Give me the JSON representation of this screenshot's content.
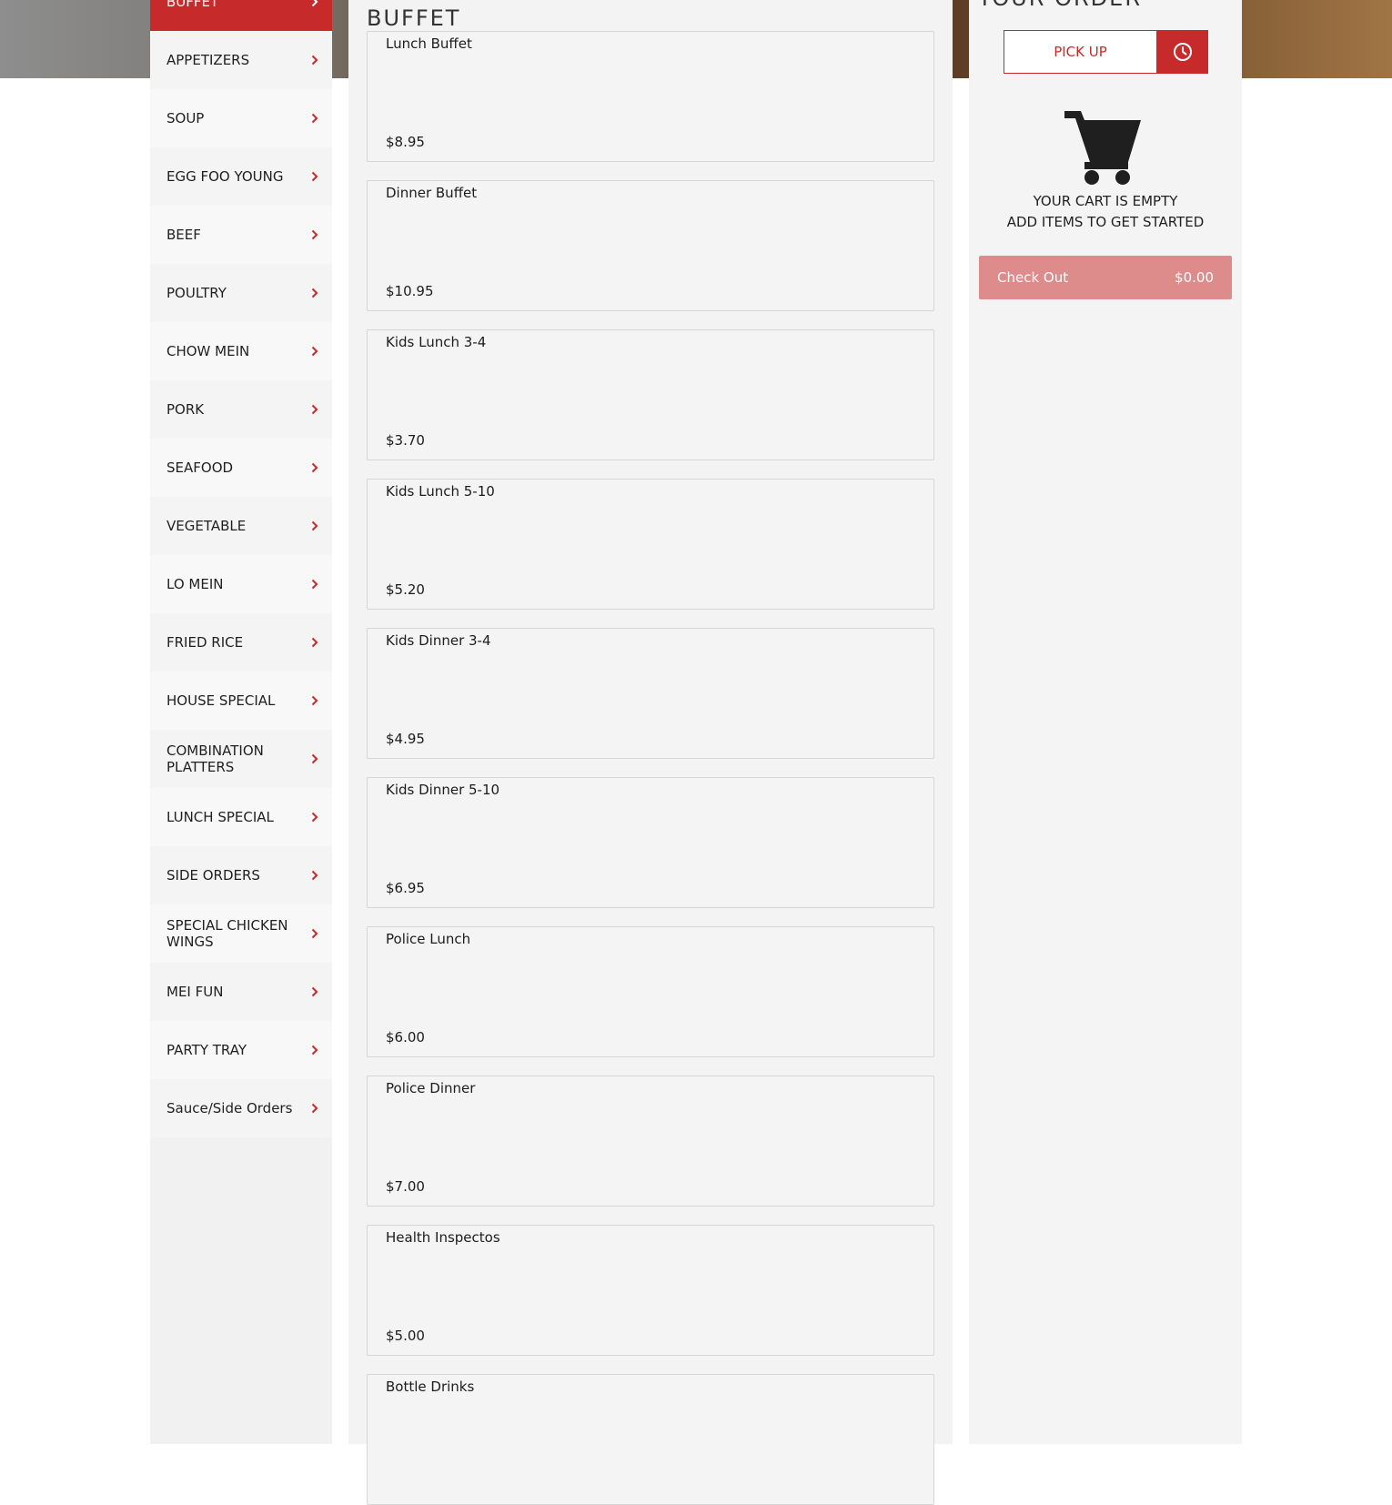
{
  "colors": {
    "accent": "#c62a2a",
    "checkout_disabled": "#dd8b8b",
    "panel_bg": "#f4f4f4"
  },
  "sidebar": {
    "items": [
      {
        "label": "BUFFET",
        "active": true
      },
      {
        "label": "APPETIZERS"
      },
      {
        "label": "SOUP"
      },
      {
        "label": "EGG FOO YOUNG"
      },
      {
        "label": "BEEF"
      },
      {
        "label": "POULTRY"
      },
      {
        "label": "CHOW MEIN"
      },
      {
        "label": "PORK"
      },
      {
        "label": "SEAFOOD"
      },
      {
        "label": "VEGETABLE"
      },
      {
        "label": "LO MEIN"
      },
      {
        "label": "FRIED RICE"
      },
      {
        "label": "HOUSE SPECIAL"
      },
      {
        "label": "COMBINATION PLATTERS"
      },
      {
        "label": "LUNCH SPECIAL"
      },
      {
        "label": "SIDE ORDERS"
      },
      {
        "label": "SPECIAL CHICKEN WINGS"
      },
      {
        "label": "MEI FUN"
      },
      {
        "label": "PARTY TRAY"
      },
      {
        "label": "Sauce/Side Orders"
      }
    ],
    "chevron_icon": "chevron-right-icon"
  },
  "main": {
    "section_title": "BUFFET",
    "items": [
      {
        "name": "Lunch Buffet",
        "price": "$8.95"
      },
      {
        "name": "Dinner Buffet",
        "price": "$10.95"
      },
      {
        "name": "Kids Lunch 3-4",
        "price": "$3.70"
      },
      {
        "name": "Kids Lunch 5-10",
        "price": "$5.20"
      },
      {
        "name": "Kids Dinner 3-4",
        "price": "$4.95"
      },
      {
        "name": "Kids Dinner 5-10",
        "price": "$6.95"
      },
      {
        "name": "Police Lunch",
        "price": "$6.00"
      },
      {
        "name": "Police Dinner",
        "price": "$7.00"
      },
      {
        "name": "Health Inspectos",
        "price": "$5.00"
      },
      {
        "name": "Bottle Drinks",
        "price": ""
      }
    ]
  },
  "order": {
    "title": "YOUR ORDER",
    "pickup_label": "PICK UP",
    "time_icon": "clock-icon",
    "cart_icon": "cart-icon",
    "empty_line1": "YOUR CART IS EMPTY",
    "empty_line2": "ADD ITEMS TO GET STARTED",
    "checkout_label": "Check Out",
    "checkout_total": "$0.00"
  }
}
